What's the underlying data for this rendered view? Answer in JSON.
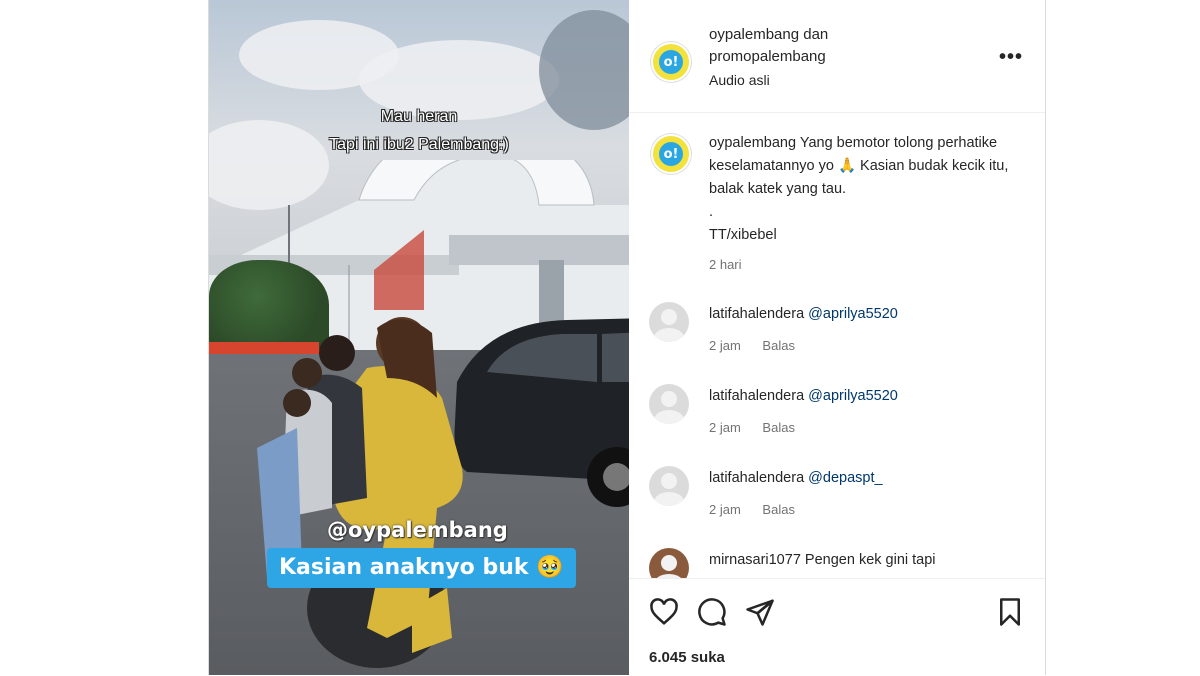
{
  "video": {
    "overlay_line1": "Mau heran",
    "overlay_line2": "Tapi ini ibu2 Palembang:)",
    "tag_handle": "@oypalembang",
    "tag_caption": "Kasian anaknyo buk 🥹"
  },
  "header": {
    "names_line1": "oypalembang dan",
    "names_line2": "promopalembang",
    "audio": "Audio asli",
    "more": "•••",
    "avatar_text": "o!"
  },
  "caption": {
    "username": "oypalembang",
    "text": "Yang bemotor tolong perhatike keselamatannyo yo 🙏 Kasian budak kecik itu, balak katek yang tau.",
    "dot": ".",
    "credit": "TT/xibebel",
    "time": "2 hari",
    "avatar_text": "o!"
  },
  "comments": [
    {
      "username": "latifahalendera",
      "mention": "@aprilya5520",
      "time": "2 jam",
      "reply": "Balas"
    },
    {
      "username": "latifahalendera",
      "mention": "@aprilya5520",
      "time": "2 jam",
      "reply": "Balas"
    },
    {
      "username": "latifahalendera",
      "mention": "@depaspt_",
      "time": "2 jam",
      "reply": "Balas"
    },
    {
      "username": "mirnasari1077",
      "text": "Pengen kek gini tapi"
    }
  ],
  "actions": {
    "likes": "6.045 suka"
  },
  "icons": [
    "heart-icon",
    "comment-icon",
    "share-icon",
    "bookmark-icon",
    "more-icon"
  ]
}
